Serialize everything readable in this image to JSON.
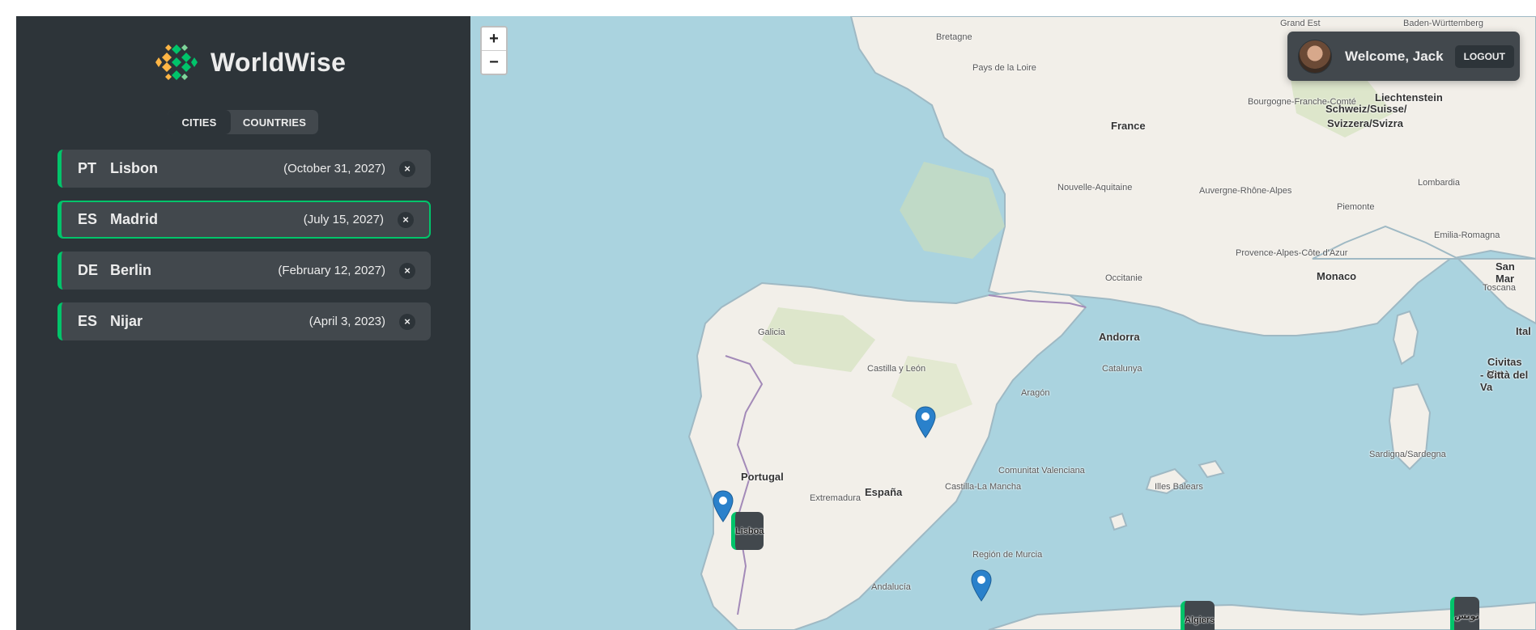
{
  "app": {
    "name": "WorldWise",
    "brand_green": "#00c46a",
    "sidebar_bg": "#2d3439",
    "item_bg": "#42484d"
  },
  "tabs": [
    {
      "label": "CITIES",
      "active": true
    },
    {
      "label": "COUNTRIES",
      "active": false
    }
  ],
  "cities": [
    {
      "code": "PT",
      "name": "Lisbon",
      "date": "(October 31, 2027)",
      "selected": false
    },
    {
      "code": "ES",
      "name": "Madrid",
      "date": "(July 15, 2027)",
      "selected": true
    },
    {
      "code": "DE",
      "name": "Berlin",
      "date": "(February 12, 2027)",
      "selected": false
    },
    {
      "code": "ES",
      "name": "Nijar",
      "date": "(April 3, 2023)",
      "selected": false
    }
  ],
  "delete_glyph": "×",
  "map": {
    "zoom_in": "+",
    "zoom_out": "−",
    "marker_icon": "map-pin-icon",
    "labels": {
      "france": "France",
      "portugal": "Portugal",
      "espana": "España",
      "andorra": "Andorra",
      "monaco": "Monaco",
      "lisboa": "Lisboa",
      "algiers": "Algiers",
      "liechtenstein": "Liechtenstein",
      "schweiz": "Schweiz/Suisse/",
      "svizzera": "Svizzera/Svizra",
      "bretagne": "Bretagne",
      "pays_loire": "Pays de la Loire",
      "nouvelle": "Nouvelle-Aquitaine",
      "occitanie": "Occitanie",
      "catalunya": "Catalunya",
      "aragon": "Aragón",
      "galicia": "Galicia",
      "extremadura": "Extremadura",
      "andalucia": "Andalucía",
      "castilla_mancha": "Castilla-La Mancha",
      "castilla_leon": "Castilla y León",
      "valenciana": "Comunitat Valenciana",
      "murcia": "Región de Murcia",
      "illes": "Illes Balears",
      "sardigna": "Sardigna/Sardegna",
      "san_mar": "San Mar",
      "civitas": "Civitas Vat",
      "citta": "- Città del Va",
      "ital": "Ital",
      "toscana": "Toscana",
      "piemonte": "Piemonte",
      "lombardia": "Lombardia",
      "emilia": "Emilia-Romagna",
      "bourgogne": "Bourgogne-Franche-Comté",
      "auvergne": "Auvergne-Rhône-Alpes",
      "provence": "Provence-Alpes-Côte d'Azur",
      "tunis": "تونس",
      "baden": "Baden-Württemberg",
      "grand_est": "Grand Est"
    }
  },
  "user": {
    "welcome": "Welcome, Jack",
    "logout": "LOGOUT"
  }
}
